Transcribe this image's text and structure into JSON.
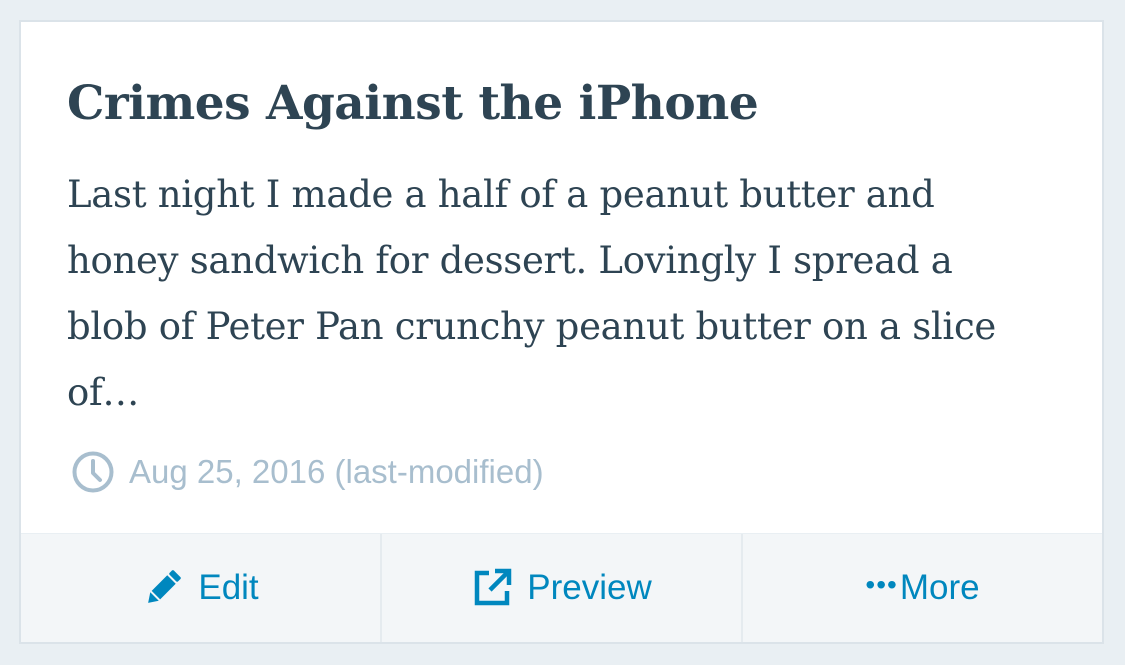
{
  "post": {
    "title": "Crimes Against the iPhone",
    "excerpt": "Last night I made a half of a peanut butter and honey sandwich for dessert. Lovingly I spread a blob of Peter Pan crunchy peanut butter on a slice of…",
    "date": "Aug 25, 2016 (last-modified)",
    "date_icon": "clock-icon"
  },
  "actions": {
    "edit_label": "Edit",
    "edit_icon": "pencil-icon",
    "preview_label": "Preview",
    "preview_icon": "external-link-icon",
    "more_dots": "•••",
    "more_label": "More"
  },
  "colors": {
    "background": "#e9eff3",
    "title": "#2e4453",
    "meta": "#a8bece",
    "accent": "#0087be",
    "actions_bg": "#f3f6f8"
  }
}
